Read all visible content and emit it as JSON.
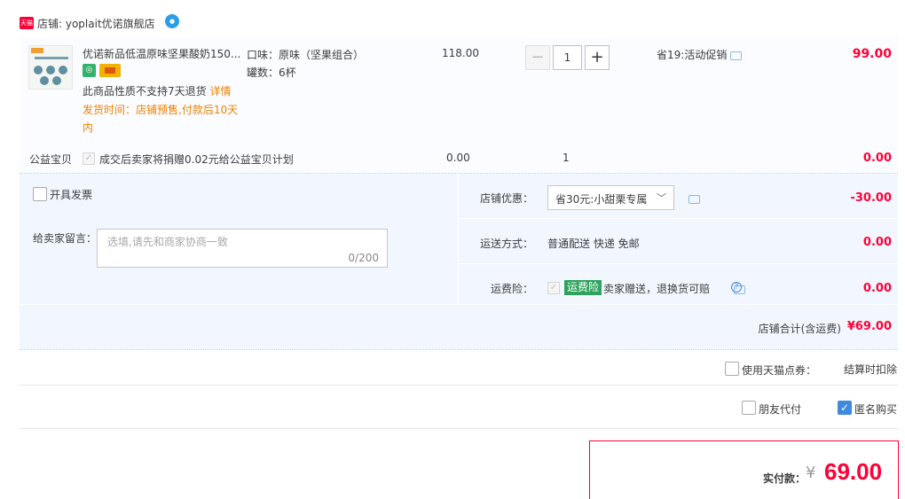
{
  "store": {
    "badge": "天猫",
    "label": "店铺: yoplait优诺旗舰店"
  },
  "item": {
    "title": "优诺新品低温原味坚果酸奶150...",
    "note_text": "此商品性质不支持7天退货",
    "note_link": "详情",
    "ship_note": "发货时间：店铺预售,付款后10天内",
    "spec_flavor": "口味：原味（坚果组合）",
    "spec_count": "罐数：6杯",
    "price": "118.00",
    "quantity": "1",
    "promo": "省19:活动促销",
    "subtotal": "99.00"
  },
  "charity": {
    "label": "公益宝贝",
    "text": "成交后卖家将捐赠0.02元给公益宝贝计划",
    "price": "0.00",
    "quantity": "1",
    "subtotal": "0.00"
  },
  "order": {
    "invoice_label": "开具发票",
    "message_label": "给卖家留言：",
    "message_placeholder": "选填,请先和商家协商一致",
    "message_count": "0/200",
    "discount_label": "店铺优惠：",
    "discount_selected": "省30元:小甜栗专属",
    "discount_amount": "-30.00",
    "shipping_label": "运送方式：",
    "shipping_value": "普通配送 快递 免邮",
    "shipping_amount": "0.00",
    "insurance_label": "运费险：",
    "insurance_badge": "运费险",
    "insurance_text": "卖家赠送，退换货可赔",
    "insurance_amount": "0.00",
    "total_label": "店铺合计(含运费)",
    "total_value": "¥69.00"
  },
  "options": {
    "points_label": "使用天猫点券：",
    "points_value": "结算时扣除",
    "friend_pay_label": "朋友代付",
    "anonymous_label": "匿名购买",
    "anonymous_checked": true
  },
  "payment": {
    "label": "实付款：",
    "currency": "¥",
    "amount": "69.00"
  },
  "colors": {
    "accent_red": "#ff0036",
    "order_bg": "#f2f7ff",
    "link_orange": "#f08000",
    "checkbox_blue": "#3f8ae0",
    "insurance_green": "#2fa35e"
  }
}
